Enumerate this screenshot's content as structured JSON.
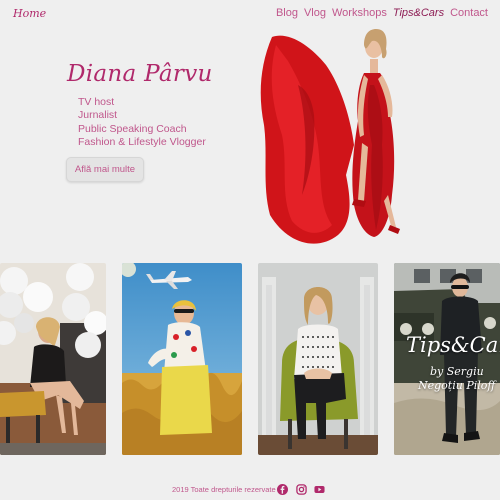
{
  "nav": {
    "home": "Home",
    "items": [
      {
        "label": "Blog",
        "active": false
      },
      {
        "label": "Vlog",
        "active": false
      },
      {
        "label": "Workshops",
        "active": false
      },
      {
        "label": "Tips&Cars",
        "active": true
      },
      {
        "label": "Contact",
        "active": false
      }
    ]
  },
  "hero": {
    "name": "Diana Pârvu",
    "roles": [
      "TV host",
      "Jurnalist",
      "Public Speaking Coach",
      "Fashion & Lifestyle Vlogger"
    ],
    "cta_label": "Află mai multe"
  },
  "tiles": {
    "tips_cars": {
      "title": "Tips&Cars",
      "by": "by Sergiu",
      "author": "Negoțiu Piloff"
    }
  },
  "footer": {
    "copyright": "2019 Toate drepturile rezervate",
    "social": [
      "facebook-icon",
      "instagram-icon",
      "youtube-icon"
    ]
  },
  "colors": {
    "accent": "#b0296b",
    "accent_light": "#c0578c",
    "background": "#efefef"
  }
}
